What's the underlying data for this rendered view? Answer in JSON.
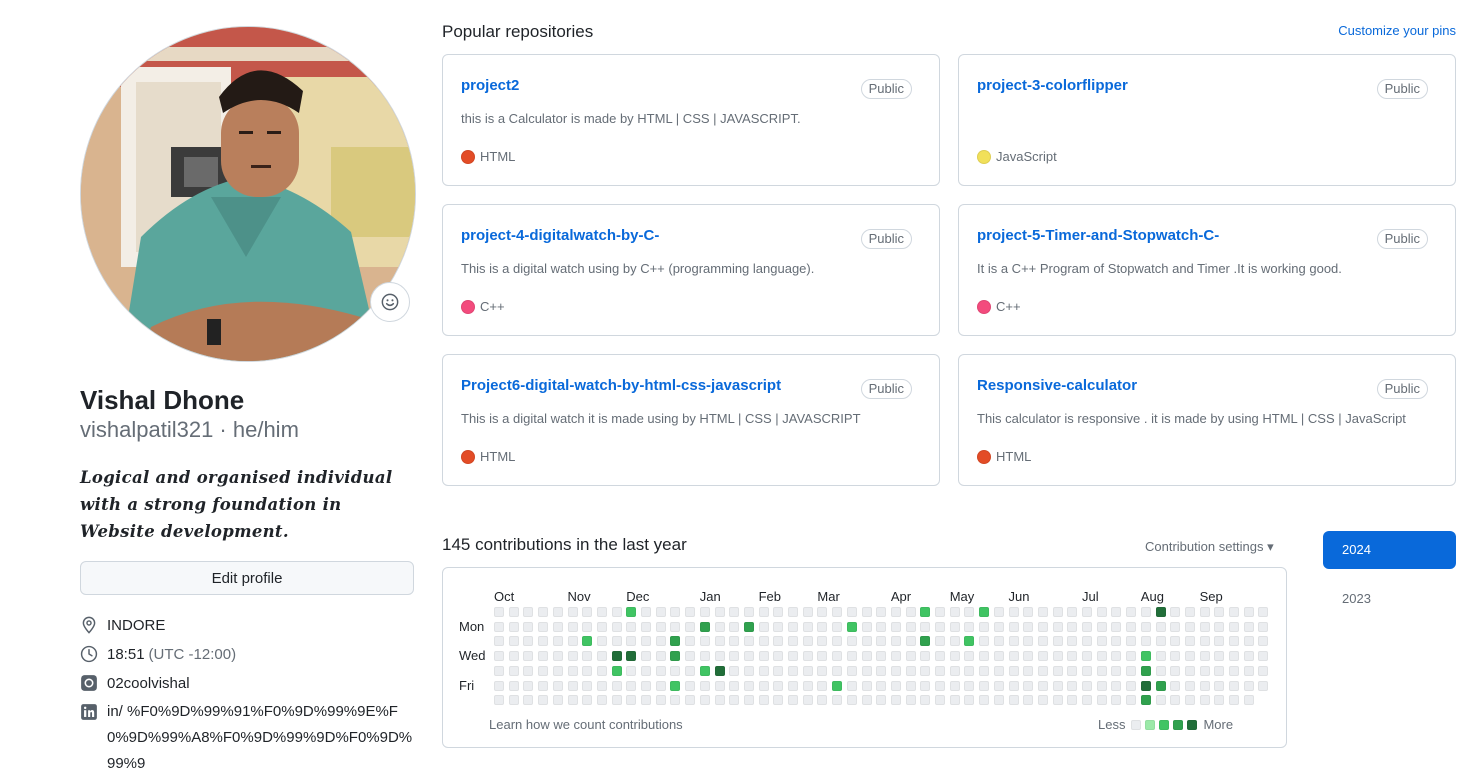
{
  "profile": {
    "name": "Vishal Dhone",
    "login_line": "vishalpatil321 · he/him",
    "bio": "Logical and organised individual with a strong foundation in Website development.",
    "edit_button": "Edit profile",
    "avatar_alt": "profile photo",
    "details": {
      "location": "INDORE",
      "time": "18:51",
      "timezone": "(UTC -12:00)",
      "instagram": "02coolvishal",
      "linkedin": "in/ %F0%9D%99%91%F0%9D%99%9E%F0%9D%99%A8%F0%9D%99%9D%F0%9D%99%9"
    }
  },
  "pinned": {
    "title": "Popular repositories",
    "customize": "Customize your pins",
    "repos": [
      {
        "name": "project2",
        "visibility": "Public",
        "description": "this is a Calculator is made by HTML | CSS | JAVASCRIPT.",
        "language": "HTML",
        "language_color": "#e34c26"
      },
      {
        "name": "project-3-colorflipper",
        "visibility": "Public",
        "description": "",
        "language": "JavaScript",
        "language_color": "#f1e05a"
      },
      {
        "name": "project-4-digitalwatch-by-C-",
        "visibility": "Public",
        "description": "This is a digital watch using by C++ (programming language).",
        "language": "C++",
        "language_color": "#f34b7d"
      },
      {
        "name": "project-5-Timer-and-Stopwatch-C-",
        "visibility": "Public",
        "description": "It is a C++ Program of Stopwatch and Timer .It is working good.",
        "language": "C++",
        "language_color": "#f34b7d"
      },
      {
        "name": "Project6-digital-watch-by-html-css-javascript",
        "visibility": "Public",
        "description": "This is a digital watch it is made using by HTML | CSS | JAVASCRIPT",
        "language": "HTML",
        "language_color": "#e34c26"
      },
      {
        "name": "Responsive-calculator",
        "visibility": "Public",
        "description": "This calculator is responsive . it is made by using HTML | CSS | JavaScript",
        "language": "HTML",
        "language_color": "#e34c26"
      }
    ]
  },
  "contributions": {
    "title": "145 contributions in the last year",
    "settings": "Contribution settings ▾",
    "months": [
      "Oct",
      "Nov",
      "Dec",
      "Jan",
      "Feb",
      "Mar",
      "Apr",
      "May",
      "Jun",
      "Jul",
      "Aug",
      "Sep"
    ],
    "month_week_index": [
      0,
      5,
      9,
      14,
      18,
      22,
      27,
      31,
      35,
      40,
      44,
      48
    ],
    "day_labels": {
      "mon": "Mon",
      "wed": "Wed",
      "fri": "Fri"
    },
    "weeks": 53,
    "levels_note": "grid levels 0-4",
    "active_cells": [
      [
        9,
        0,
        2
      ],
      [
        45,
        0,
        4
      ],
      [
        29,
        0,
        2
      ],
      [
        33,
        0,
        2
      ],
      [
        14,
        1,
        3
      ],
      [
        17,
        1,
        3
      ],
      [
        24,
        1,
        2
      ],
      [
        6,
        2,
        2
      ],
      [
        12,
        2,
        3
      ],
      [
        32,
        2,
        2
      ],
      [
        29,
        2,
        3
      ],
      [
        8,
        3,
        4
      ],
      [
        9,
        3,
        4
      ],
      [
        12,
        3,
        3
      ],
      [
        44,
        3,
        2
      ],
      [
        8,
        4,
        2
      ],
      [
        14,
        4,
        2
      ],
      [
        15,
        4,
        4
      ],
      [
        44,
        4,
        3
      ],
      [
        12,
        5,
        2
      ],
      [
        23,
        5,
        2
      ],
      [
        44,
        5,
        4
      ],
      [
        45,
        5,
        3
      ],
      [
        44,
        6,
        3
      ]
    ],
    "level_colors": [
      "#ebedf0",
      "#9be9a8",
      "#40c463",
      "#30a14e",
      "#216e39"
    ],
    "learn": "Learn how we count contributions",
    "legend_less": "Less",
    "legend_more": "More"
  },
  "years": {
    "active": "2024",
    "other": "2023"
  }
}
